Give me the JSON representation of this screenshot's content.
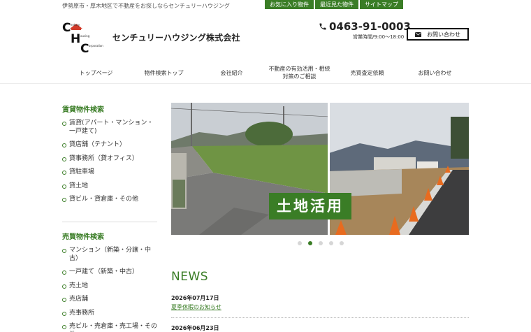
{
  "tagline": "伊勢原市・厚木地区で不動産をお探しならセンチュリーハウジング",
  "top_nav": [
    "お気に入り物件",
    "最近見た物件",
    "サイトマップ"
  ],
  "company_name": "センチュリーハウジング株式会社",
  "logo": {
    "letters": [
      "C",
      "H",
      "C"
    ],
    "small_words": [
      "entury",
      "ousing",
      "orporation"
    ],
    "icon": "house-roof-logo"
  },
  "phone": {
    "icon": "phone-icon",
    "number": "0463-91-0003",
    "hours": "営業時間/9:00～18:00"
  },
  "contact_button": {
    "icon": "envelope-icon",
    "label": "お問い合わせ"
  },
  "main_nav": [
    {
      "label": "トップページ"
    },
    {
      "label": "物件検索トップ"
    },
    {
      "label": "会社紹介"
    },
    {
      "label": "不動産の有効活用・相続\n対策のご相談"
    },
    {
      "label": "売買査定依頼"
    },
    {
      "label": "お問い合わせ"
    }
  ],
  "sidebar": {
    "rental": {
      "title": "賃貸物件検索",
      "items": [
        "賃貸(アパート・マンション・一戸建て)",
        "貸店舗（テナント）",
        "貸事務所（貸オフィス）",
        "貸駐車場",
        "貸土地",
        "貸ビル・貸倉庫・その他"
      ]
    },
    "sale": {
      "title": "売買物件検索",
      "items": [
        "マンション（新築・分譲・中古）",
        "一戸建て（新築・中古）",
        "売土地",
        "売店舗",
        "売事務所",
        "売ビル・売倉庫・売工場・その他"
      ]
    }
  },
  "slider": {
    "caption": "土地活用",
    "total_slides": 5,
    "active_slide": 2
  },
  "colors": {
    "accent": "#3a7d26",
    "logo_red": "#d23a2a"
  },
  "news": {
    "heading": "NEWS",
    "items": [
      {
        "date": "2026年07月17日",
        "title": "夏季休暇のお知らせ"
      },
      {
        "date": "2026年06月23日",
        "title": ""
      }
    ]
  }
}
